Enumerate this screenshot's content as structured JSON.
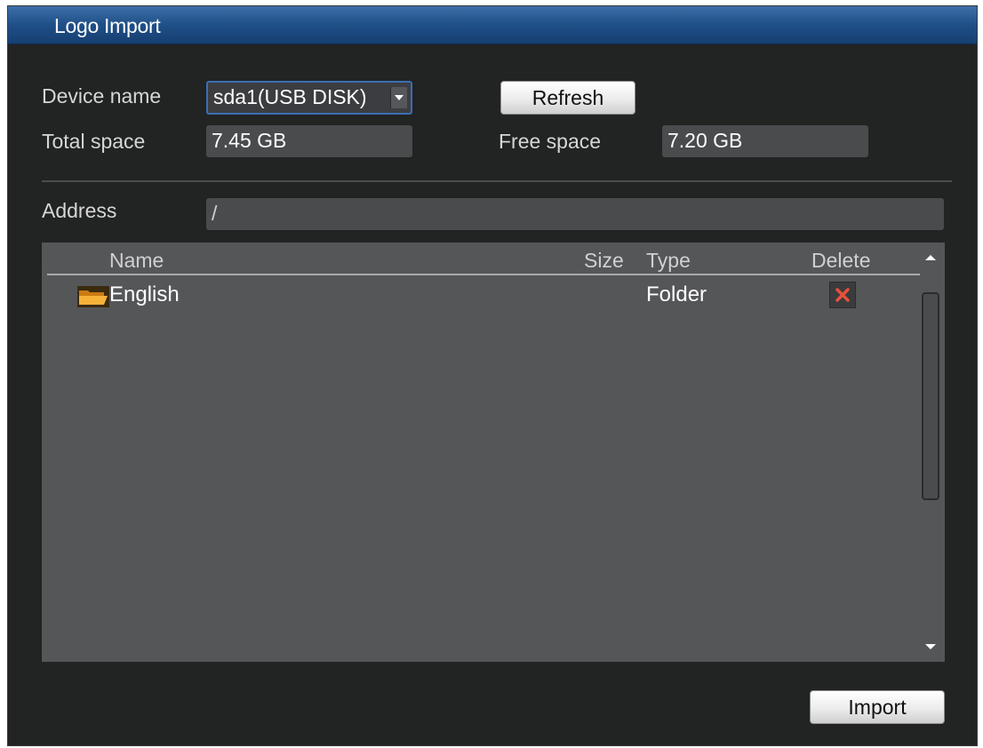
{
  "window": {
    "title": "Logo Import"
  },
  "device": {
    "name_label": "Device name",
    "selected": "sda1(USB DISK)",
    "refresh_label": "Refresh",
    "total_label": "Total space",
    "total_value": "7.45 GB",
    "free_label": "Free space",
    "free_value": "7.20 GB"
  },
  "address": {
    "label": "Address",
    "value": "/"
  },
  "filelist": {
    "columns": [
      "Name",
      "Size",
      "Type",
      "Delete"
    ],
    "rows": [
      {
        "name": "English",
        "size": "",
        "type": "Folder",
        "icon": "folder-icon",
        "delete_icon": "delete-x-icon"
      }
    ]
  },
  "actions": {
    "import_label": "Import"
  },
  "colors": {
    "titlebar": "#1f4f87",
    "panel": "#222323",
    "list_bg": "#555658",
    "delete_x": "#e9503a",
    "folder": "#f2a01f"
  }
}
